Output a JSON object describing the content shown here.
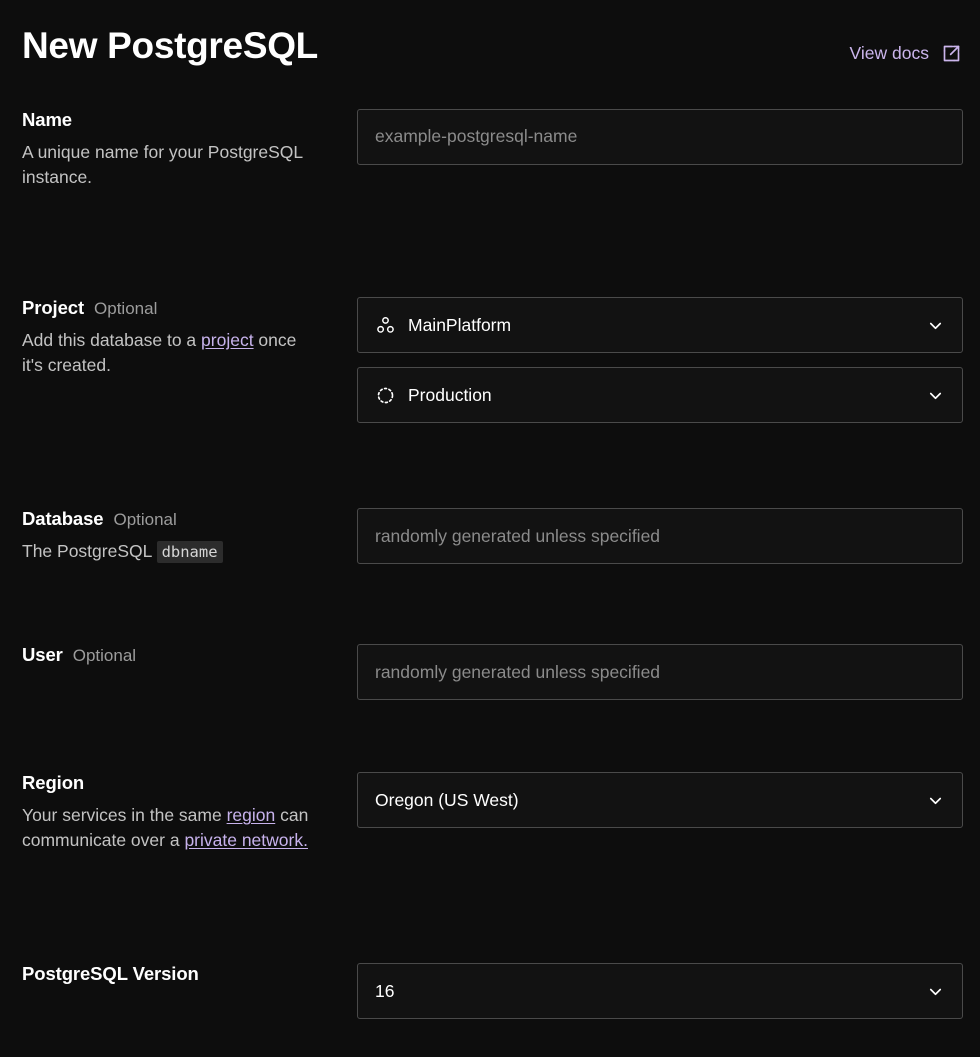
{
  "header": {
    "title": "New PostgreSQL",
    "docs_label": "View docs",
    "docs_icon": "external-link-icon"
  },
  "colors": {
    "background": "#0d0d0d",
    "field_background": "#121212",
    "field_border": "#4a4a4a",
    "text_primary": "#ffffff",
    "text_secondary": "#c3c3c3",
    "text_muted": "#8b8b8b",
    "link_purple": "#c7b2ec",
    "code_chip_background": "#2c2c2c"
  },
  "sections": {
    "name": {
      "label": "Name",
      "optional": "",
      "desc_pre": "A unique name for your PostgreSQL instance.",
      "input_value": "",
      "input_placeholder": "example-postgresql-name"
    },
    "project": {
      "label": "Project",
      "optional": "Optional",
      "desc_pre": "Add this database to a ",
      "desc_link": "project",
      "desc_post": " once it's created.",
      "project_select": {
        "value": "MainPlatform",
        "icon": "group-cluster-icon",
        "chevron": "chevron-down-icon"
      },
      "environment_select": {
        "value": "Production",
        "icon": "dashed-circle-icon",
        "chevron": "chevron-down-icon"
      }
    },
    "database": {
      "label": "Database",
      "optional": "Optional",
      "desc_pre": "The PostgreSQL ",
      "desc_code": "dbname",
      "input_value": "",
      "input_placeholder": "randomly generated unless specified"
    },
    "user": {
      "label": "User",
      "optional": "Optional",
      "input_value": "",
      "input_placeholder": "randomly generated unless specified"
    },
    "region": {
      "label": "Region",
      "optional": "",
      "desc_pre": "Your services in the same ",
      "desc_link1": "region",
      "desc_mid": " can communicate over a ",
      "desc_link2": "private network.",
      "select": {
        "value": "Oregon (US West)",
        "chevron": "chevron-down-icon"
      }
    },
    "version": {
      "label": "PostgreSQL Version",
      "optional": "",
      "select": {
        "value": "16",
        "chevron": "chevron-down-icon"
      }
    }
  }
}
